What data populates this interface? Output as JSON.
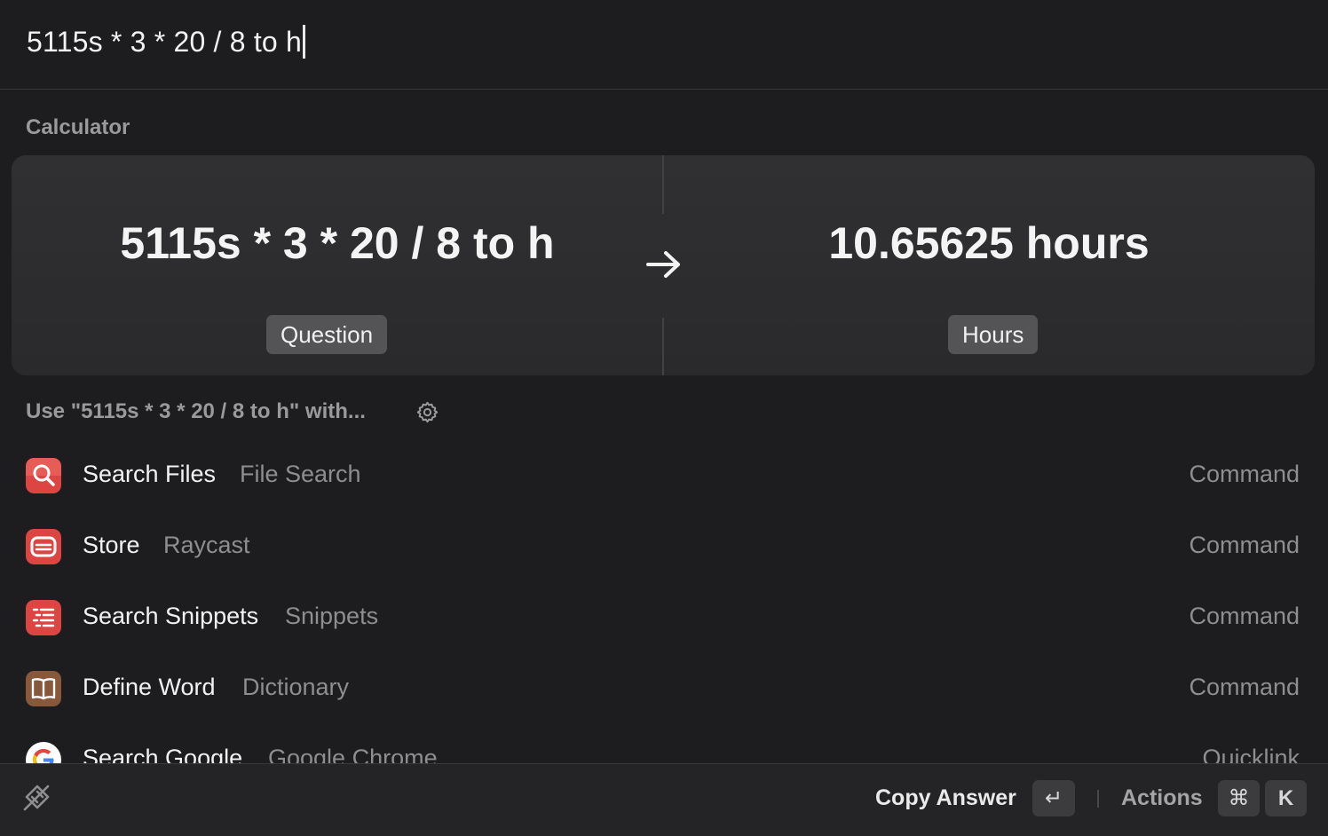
{
  "search": {
    "query": "5115s * 3 * 20 / 8 to h"
  },
  "calculator": {
    "section_title": "Calculator",
    "question": "5115s * 3 * 20 / 8 to h",
    "question_tag": "Question",
    "answer": "10.65625 hours",
    "answer_tag": "Hours"
  },
  "use_with": {
    "label": "Use \"5115s * 3 * 20 / 8 to h\" with..."
  },
  "results": [
    {
      "title": "Search Files",
      "subtitle": "File Search",
      "kind": "Command",
      "icon": "magnifier-icon",
      "color": "#e04a46"
    },
    {
      "title": "Store",
      "subtitle": "Raycast",
      "kind": "Command",
      "icon": "store-icon",
      "color": "#e04a46"
    },
    {
      "title": "Search Snippets",
      "subtitle": "Snippets",
      "kind": "Command",
      "icon": "snippets-icon",
      "color": "#e04a46"
    },
    {
      "title": "Define Word",
      "subtitle": "Dictionary",
      "kind": "Command",
      "icon": "book-icon",
      "color": "#8a5a3a"
    },
    {
      "title": "Search Google",
      "subtitle": "Google Chrome",
      "kind": "Quicklink",
      "icon": "google-icon",
      "color": "#ffffff"
    }
  ],
  "footer": {
    "primary_action": "Copy Answer",
    "enter_key": "↵",
    "actions_label": "Actions",
    "cmd_key": "⌘",
    "k_key": "K"
  }
}
